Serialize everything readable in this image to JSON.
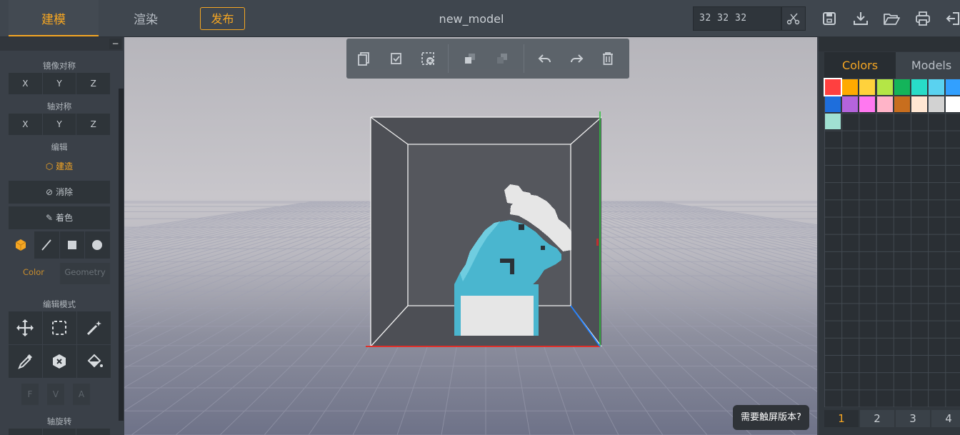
{
  "header": {
    "tab_model": "建模",
    "tab_render": "渲染",
    "publish": "发布",
    "title": "new_model",
    "dimensions": "32 32 32",
    "tool_icons": [
      "save-icon",
      "download-icon",
      "open-folder-icon",
      "print-icon",
      "exit-icon"
    ]
  },
  "left": {
    "mirror_label": "镜像对称",
    "mirror_axes": [
      "X",
      "Y",
      "Z"
    ],
    "axis_label": "轴对称",
    "axis_axes": [
      "X",
      "Y",
      "Z"
    ],
    "edit_label": "编辑",
    "build": "建造",
    "erase": "消除",
    "paint": "着色",
    "color_tab": "Color",
    "geometry_tab": "Geometry",
    "edit_mode_label": "编辑模式",
    "fva": [
      "F",
      "V",
      "A"
    ],
    "rotate_label": "轴旋转"
  },
  "viewport": {
    "touch_prompt": "需要触屏版本?"
  },
  "right": {
    "tab_colors": "Colors",
    "tab_models": "Models",
    "palette": [
      "#ff4040",
      "#ffaa00",
      "#ffd23c",
      "#b4e646",
      "#14b45a",
      "#28dcc8",
      "#5ad2f0",
      "#32a0ff",
      "#1e6edc",
      "#b464dc",
      "#ff78f0",
      "#ffb4c8",
      "#c86e1e",
      "#ffe6d2",
      "#d2d2d2",
      "#ffffff",
      "#a0e1d2"
    ],
    "selected_color": "#ff4040",
    "pages": [
      "1",
      "2",
      "3",
      "4"
    ],
    "active_page": "1"
  },
  "colors": {
    "accent": "#f5a623"
  }
}
